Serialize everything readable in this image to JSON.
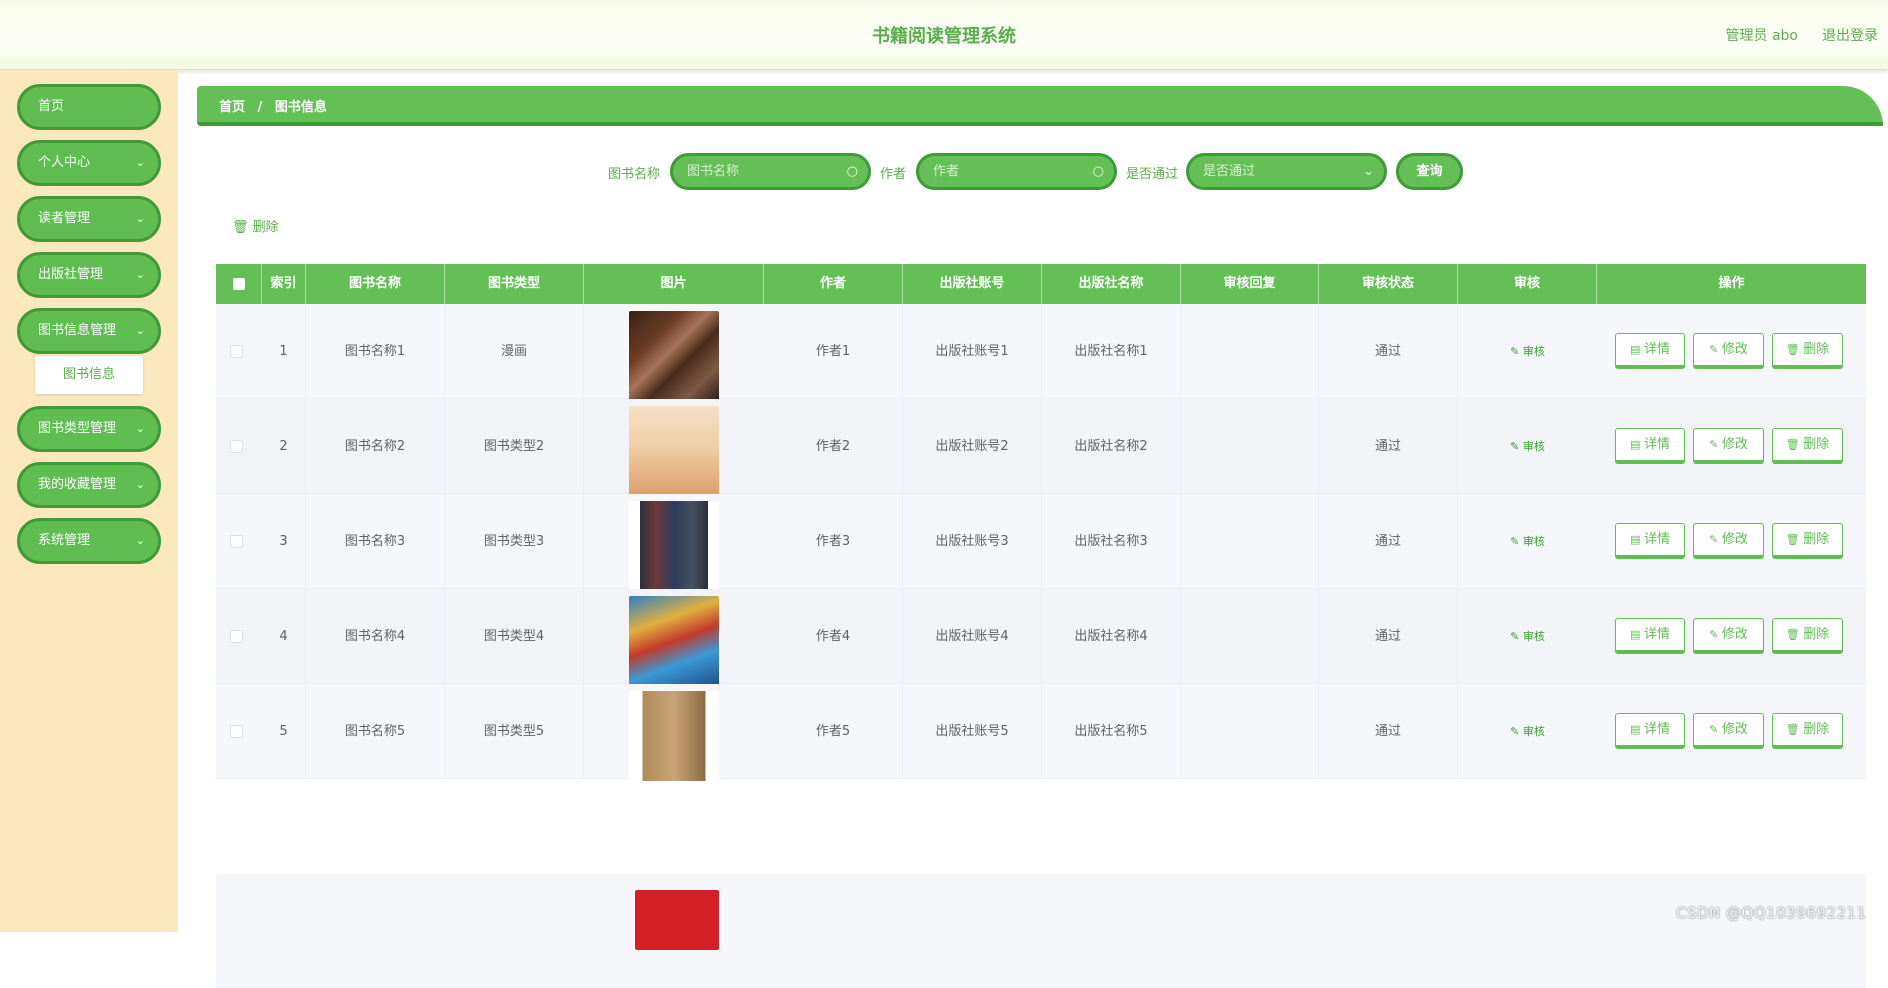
{
  "header": {
    "title": "书籍阅读管理系统",
    "user": "管理员 abo",
    "logout": "退出登录"
  },
  "sidebar": {
    "items": [
      {
        "label": "首页",
        "chevron": false
      },
      {
        "label": "个人中心",
        "chevron": true
      },
      {
        "label": "读者管理",
        "chevron": true
      },
      {
        "label": "出版社管理",
        "chevron": true
      },
      {
        "label": "图书信息管理",
        "chevron": true,
        "expanded": true
      },
      {
        "label": "图书类型管理",
        "chevron": true
      },
      {
        "label": "我的收藏管理",
        "chevron": true
      },
      {
        "label": "系统管理",
        "chevron": true
      }
    ],
    "sub_item": "图书信息",
    "chevron_icon": "chevron-down-icon"
  },
  "breadcrumb": {
    "home": "首页",
    "separator": "/",
    "current": "图书信息"
  },
  "search": {
    "name_label": "图书名称",
    "name_placeholder": "图书名称",
    "author_label": "作者",
    "author_placeholder": "作者",
    "passed_label": "是否通过",
    "passed_placeholder": "是否通过",
    "query_button": "查询"
  },
  "toolbar": {
    "delete_label": "删除"
  },
  "table": {
    "headers": [
      "索引",
      "图书名称",
      "图书类型",
      "图片",
      "作者",
      "出版社账号",
      "出版社名称",
      "审核回复",
      "审核状态",
      "审核",
      "操作"
    ],
    "rows": [
      {
        "index": "1",
        "name": "图书名称1",
        "type": "漫画",
        "author": "作者1",
        "pub_account": "出版社账号1",
        "pub_name": "出版社名称1",
        "reply": "",
        "status": "通过",
        "image": "stacked-books"
      },
      {
        "index": "2",
        "name": "图书名称2",
        "type": "图书类型2",
        "author": "作者2",
        "pub_account": "出版社账号2",
        "pub_name": "出版社名称2",
        "reply": "",
        "status": "通过",
        "image": "wheat-field-cover"
      },
      {
        "index": "3",
        "name": "图书名称3",
        "type": "图书类型3",
        "author": "作者3",
        "pub_account": "出版社账号3",
        "pub_name": "出版社名称3",
        "reply": "",
        "status": "通过",
        "image": "boxed-book-set"
      },
      {
        "index": "4",
        "name": "图书名称4",
        "type": "图书类型4",
        "author": "作者4",
        "pub_account": "出版社账号4",
        "pub_name": "出版社名称4",
        "reply": "",
        "status": "通过",
        "image": "anime-poster"
      },
      {
        "index": "5",
        "name": "图书名称5",
        "type": "图书类型5",
        "author": "作者5",
        "pub_account": "出版社账号5",
        "pub_name": "出版社名称5",
        "reply": "",
        "status": "通过",
        "image": "brown-book-cover"
      }
    ],
    "actions": {
      "audit": "审核",
      "detail": "详情",
      "edit": "修改",
      "delete": "删除"
    }
  },
  "watermark": "CSDN @QQ1039692211",
  "colors": {
    "primary": "#64bf57",
    "primary_dark": "#3f9a37",
    "sidebar_bg": "#fde7bc",
    "text_green": "#5bae4d"
  }
}
